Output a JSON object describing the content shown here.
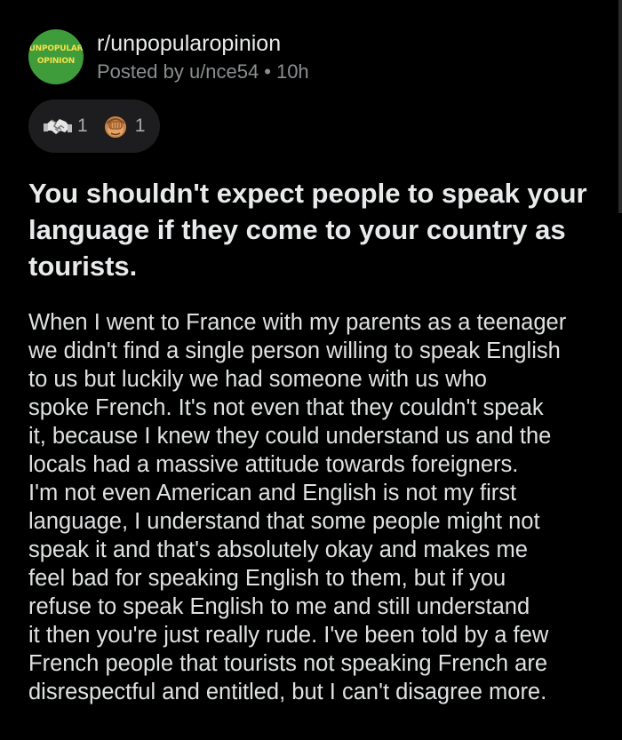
{
  "post": {
    "subreddit": "r/unpopularopinion",
    "subreddit_logo": {
      "line1": "UNPOPULAR",
      "line2": "OPINION"
    },
    "posted_by": "Posted by u/nce54",
    "separator": "•",
    "age": "10h",
    "awards": [
      {
        "icon": "handshake-award-icon",
        "count": "1"
      },
      {
        "icon": "facepalm-award-icon",
        "count": "1"
      }
    ],
    "title": "You shouldn't expect people to speak your language if they come to your country as tourists.",
    "body_lines": [
      "When I went to France with my parents as a teenager",
      "we didn't find a single person willing to speak English",
      "to us but luckily we had someone with us who",
      "spoke French. It's not even that they couldn't speak",
      "it, because I knew they could understand us and the",
      "locals had a massive attitude towards foreigners.",
      "I'm not even American and English is not my first",
      "language, I understand that some people might not",
      "speak it and that's absolutely okay and makes me",
      "feel bad for speaking English to them, but if you",
      "refuse to speak English to me and still understand",
      "it then you're just really rude. I've been told by a few",
      "French people that tourists not speaking French are",
      "disrespectful and entitled, but I can't disagree more."
    ]
  },
  "colors": {
    "background": "#000000",
    "avatar_green": "#3f9c3a",
    "avatar_text": "#f2e14c",
    "muted_text": "#8b8e90",
    "award_pill": "#1d1d1f"
  }
}
